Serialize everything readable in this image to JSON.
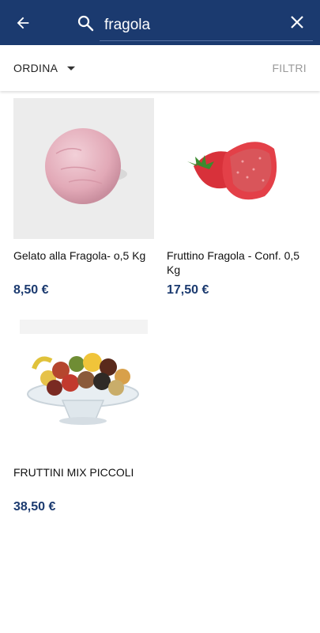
{
  "search": {
    "query": "fragola"
  },
  "toolbar": {
    "sort_label": "ORDINA",
    "filter_label": "FILTRI"
  },
  "colors": {
    "appbar": "#1b3a6f",
    "price": "#1b3a6f",
    "filter_disabled": "#9a9a9a"
  },
  "products": [
    {
      "name": "Gelato alla Fragola- o,5 Kg",
      "price": "8,50 €",
      "image": "pink-gelato-scoop"
    },
    {
      "name": "Fruttino Fragola - Conf. 0,5 Kg",
      "price": "17,50 €",
      "image": "strawberry-fruttini"
    },
    {
      "name": "FRUTTINI MIX PICCOLI",
      "price": "38,50 €",
      "image": "mixed-fruttini-on-glass-stand"
    }
  ]
}
